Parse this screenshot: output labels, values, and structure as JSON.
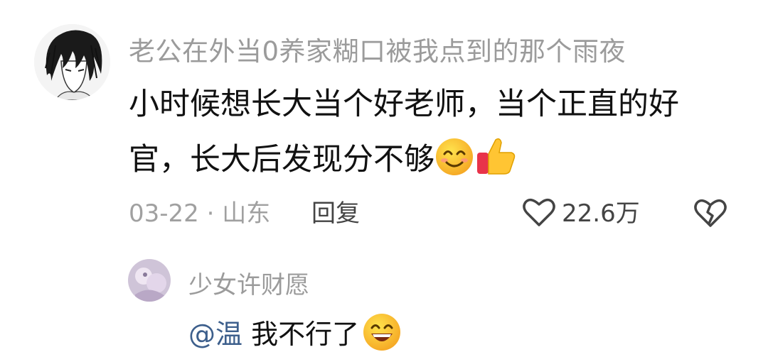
{
  "comment": {
    "username": "老公在外当0养家糊口被我点到的那个雨夜",
    "text": "小时候想长大当个好老师，当个正直的好官，长大后发现分不够",
    "emojis": [
      "smiling-face-icon",
      "thumbs-up-icon"
    ],
    "date": "03-22",
    "separator": "·",
    "location": "山东",
    "reply_label": "回复",
    "like_count": "22.6万"
  },
  "reply": {
    "username": "少女许财愿",
    "mention": "@温",
    "text": "我不行了",
    "emoji": "grinning-face-icon"
  },
  "colors": {
    "username": "#9b9b9b",
    "text": "#111111",
    "mention": "#3d5f8c",
    "meta": "#a0a0a0"
  }
}
